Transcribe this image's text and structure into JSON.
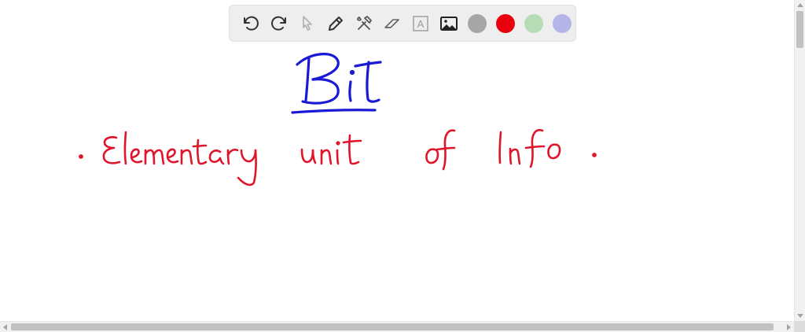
{
  "toolbar": {
    "tools": [
      {
        "name": "undo",
        "icon": "undo-icon"
      },
      {
        "name": "redo",
        "icon": "redo-icon"
      },
      {
        "name": "select",
        "icon": "pointer-icon"
      },
      {
        "name": "pen",
        "icon": "pen-icon"
      },
      {
        "name": "tools",
        "icon": "tools-icon"
      },
      {
        "name": "eraser",
        "icon": "eraser-icon"
      },
      {
        "name": "text",
        "icon": "text-box-icon",
        "label": "A"
      },
      {
        "name": "image",
        "icon": "image-icon"
      }
    ],
    "colors": [
      {
        "name": "gray",
        "hex": "#a6a6a6"
      },
      {
        "name": "red",
        "hex": "#e8000f"
      },
      {
        "name": "green",
        "hex": "#b6dcb6"
      },
      {
        "name": "lavender",
        "hex": "#b5b5ea"
      }
    ],
    "selected_color": "red"
  },
  "canvas": {
    "heading": "Bit",
    "heading_color": "#1a1ad6",
    "line1": ". Elementary unit of Info.",
    "line1_color": "#e0142a"
  }
}
